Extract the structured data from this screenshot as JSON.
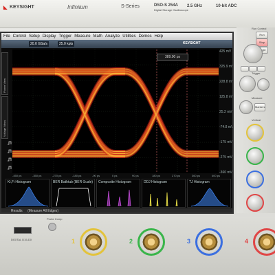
{
  "brand": {
    "logo_text": "KEYSIGHT",
    "product_line": "Infiniium",
    "series": "S-Series",
    "model": "DSO-S 254A",
    "model_sub": "Digital Storage Oscilloscope",
    "bandwidth": "2.5 GHz",
    "adc": "10-bit ADC"
  },
  "menu": {
    "items": [
      "File",
      "Control",
      "Setup",
      "Display",
      "Trigger",
      "Measure",
      "Math",
      "Analyze",
      "Utilities",
      "Demos",
      "Help"
    ],
    "sample_rate": "20.0 GSa/s",
    "memory": "25.0 kpts",
    "logo_right": "KEYSIGHT"
  },
  "colors": {
    "accent": "#d9221c",
    "wave_core": "#ffe04d",
    "wave_mid": "#ff8a1f",
    "wave_edge": "#c01a1a",
    "screen_bg": "#000000"
  },
  "waveform": {
    "x_ticks": [
      "-450 ps",
      "-350 ps",
      "-270 ps",
      "-180 ps",
      "-90 ps",
      "0 ps",
      "90 ps",
      "180 ps",
      "270 ps",
      "360 ps",
      "400 ps"
    ],
    "y_ticks": [
      "425 mV",
      "325.9 mV",
      "228.8 mV",
      "125.8 mV",
      "25.2 mV",
      "-74.8 mV",
      "-175 mV",
      "-275 mV",
      "-360 mV"
    ],
    "marker_label": "389.00 ps",
    "side_labels": [
      "Power View",
      "Voltage Meas"
    ]
  },
  "panels": [
    {
      "caption": "Ki,Fi Histogram",
      "color": "#3a7be0"
    },
    {
      "caption": "BER Bathtub (BER-Scale)",
      "color": "#ffffff"
    },
    {
      "caption": "Composite Histogram",
      "color": "#c04bd6"
    },
    {
      "caption": "DDJ Histogram",
      "color": "#f2e84a"
    },
    {
      "caption": "TJ Histogram",
      "color": "#3a7be0"
    }
  ],
  "status": {
    "results_label": "Results",
    "measure_label": "(Measure All Edges)"
  },
  "right_panel": {
    "section_runctl": "Run Control",
    "run_label": "Run",
    "stop_label": "Stop",
    "single_label": "Single",
    "section_trigger": "Trigger",
    "section_measure": "Measure",
    "marker_label": "Markers",
    "vertical_label": "Vertical"
  },
  "front_panel": {
    "label_left": "DIGITAL D15-D0",
    "probe_comp": "Probe Comp",
    "channels": [
      {
        "num": "1",
        "color": "#e3c33b"
      },
      {
        "num": "2",
        "color": "#39b54a"
      },
      {
        "num": "3",
        "color": "#3b6fe0"
      },
      {
        "num": "4",
        "color": "#e04646"
      }
    ]
  }
}
